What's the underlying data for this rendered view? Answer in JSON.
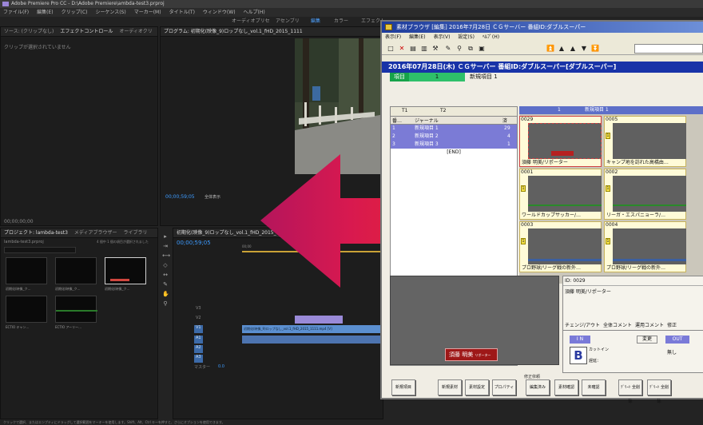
{
  "premiere": {
    "title": "Adobe Premiere Pro CC - D:\\Adobe Premiere\\ambda-test3.prproj",
    "menu": [
      "ファイル(F)",
      "編集(E)",
      "クリップ(C)",
      "シーケンス(S)",
      "マーカー(M)",
      "タイトル(T)",
      "ウィンドウ(W)",
      "ヘルプ(H)"
    ],
    "workspaces": [
      "オーディオプリセ",
      "アセンブリ",
      "編集",
      "カラー",
      "エフェクト",
      "オーディオ",
      "タイトル"
    ],
    "source_tabs": [
      "ソース: (クリップなし)",
      "エフェクトコントロール",
      "オーディオクリ"
    ],
    "source_empty": "クリップが選択されていません",
    "program_label": "プログラム: 初期化(映像_9)ロップなし_vol.1_fHD_2015_1111",
    "program_timecode": "00;00;59;05",
    "program_fit": "全体表示",
    "source_timecode": "00;00;00;00",
    "project_tabs": [
      "プロジェクト: lambda-test3",
      "メディアブラウザー",
      "ライブラリ"
    ],
    "project_file": "lambda-test3.prproj",
    "project_count": "4 個中 1 個の項目が選択されました",
    "project_items": [
      {
        "label": "初期化(映像_ク…",
        "dur": "1:19:1:5"
      },
      {
        "label": "初期化(映像_ク…",
        "dur": "1:14:19"
      },
      {
        "label": "初期化(映像_ク…",
        "dur": "1:14:19"
      },
      {
        "label": "ECTIO キャン…",
        "dur": "5:22"
      },
      {
        "label": "ECTIO アーリー…",
        "dur": "5:22"
      }
    ],
    "timeline_tab": "初期化(映像_9)ロップなし_vol.1_fHD_2015_1111",
    "timeline_timecode": "00;00;59;05",
    "ruler": [
      "00;00",
      "00;00;16;00"
    ],
    "tracks": [
      "V3",
      "V2",
      "V1",
      "A1",
      "A2",
      "A3",
      "マスター"
    ],
    "clip_v1": "初期化(映像_9)ロップなし_vol.1_fHD_2015_1111.mp4 [V]",
    "master_val": "0.0",
    "status": "クリックで選択、またはエンプティにドラッグして選択範囲をマーキーを使用します。Shift、Alt、Ctrl キーを押すと、さらにオプションを使用できます。"
  },
  "app": {
    "title": "素材ブラウザ [編集] 2016年7月28日 ＣＧサーバー 番組ID:ダブルスーパー",
    "menu": [
      "表示(F)",
      "編集(E)",
      "表示(V)",
      "設定(S)",
      "ﾍﾙﾌﾟ(H)"
    ],
    "date_bar": "2016年07月28日(木) ＣＧサーバー 番組ID:ダブルスーパー[ダブルスーパー]",
    "item_label": "項目",
    "item_num": "1",
    "item_name": "新規項目 1",
    "tabs": [
      "T1",
      "T2"
    ],
    "list_headers": [
      "番…",
      "ジャーナル",
      "済"
    ],
    "list_rows": [
      {
        "no": "1",
        "name": "新規項目 1",
        "count": "29"
      },
      {
        "no": "2",
        "name": "新規項目 2",
        "count": "4"
      },
      {
        "no": "3",
        "name": "新規項目 3",
        "count": "1"
      }
    ],
    "list_end": "[END]",
    "grid_header_num": "1",
    "grid_header_title": "新規項目 1",
    "cells": [
      {
        "num": "0029",
        "cap": "須藤 明美/リポーター"
      },
      {
        "num": "0005",
        "cap": "キャンプ地を訪れた高橋由…"
      },
      {
        "num": "0001",
        "cap": "ワールドカップサッカー/…"
      },
      {
        "num": "0002",
        "cap": "リーガ・エスパニョーラ/…"
      },
      {
        "num": "0003",
        "cap": "プロ野球/リーグ戦の新外…"
      },
      {
        "num": "0004",
        "cap": "プロ野球/リーグ戦の新外…"
      }
    ],
    "lower_name": "須藤 明美",
    "lower_sub": "リポーター",
    "detail_id": "ID: 0029",
    "detail_title": "須藤 明美/リポーター",
    "detail_tabs": [
      "チェンジ/アウト",
      "全体コメント",
      "運用コメント",
      "修正"
    ],
    "in_label": "I N",
    "out_label": "OUT",
    "change_btn": "変更",
    "cut_in": "カットイン",
    "B_label": "B",
    "delay_label": "遅延：",
    "none_label": "無し",
    "buttons": [
      "新規項目",
      "新規素材",
      "素材設定",
      "プロパティ",
      "編集済み",
      "素材確認",
      "更新記",
      "未確認",
      "ﾃﾞﾘｰﾄ 全削除",
      "ﾃﾞﾘｰﾄ 全削除"
    ],
    "fix_label": "修正依頼"
  },
  "colors": {
    "arrow": "#d8194f",
    "accent": "#1833a8",
    "blue": "#3d9bff"
  }
}
